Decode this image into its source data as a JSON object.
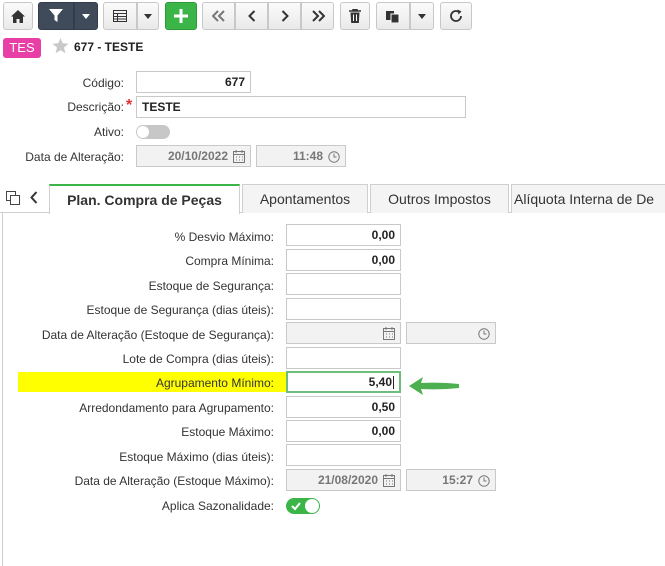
{
  "record": {
    "badge": "TES",
    "title": "677 - TESTE"
  },
  "header_form": {
    "codigo_label": "Código:",
    "codigo_value": "677",
    "descricao_label": "Descrição:",
    "descricao_required": "*",
    "descricao_value": "TESTE",
    "ativo_label": "Ativo:",
    "ativo_on": false,
    "data_alteracao_label": "Data de Alteração:",
    "data_alteracao_date": "20/10/2022",
    "data_alteracao_time": "11:48"
  },
  "tabs": [
    {
      "label": "Plan. Compra de Peças",
      "active": true
    },
    {
      "label": "Apontamentos",
      "active": false
    },
    {
      "label": "Outros Impostos",
      "active": false
    },
    {
      "label": "Alíquota Interna de De",
      "active": false
    }
  ],
  "fields": {
    "desvio_maximo": {
      "label": "% Desvio Máximo:",
      "value": "0,00"
    },
    "compra_minima": {
      "label": "Compra Mínima:",
      "value": "0,00"
    },
    "estoque_seguranca": {
      "label": "Estoque de Segurança:",
      "value": ""
    },
    "estoque_seguranca_dias": {
      "label": "Estoque de Segurança (dias úteis):",
      "value": ""
    },
    "data_alteracao_seguranca": {
      "label": "Data de Alteração (Estoque de Segurança):",
      "date": "",
      "time": ""
    },
    "lote_compra": {
      "label": "Lote de Compra (dias úteis):",
      "value": ""
    },
    "agrupamento_minimo": {
      "label": "Agrupamento Mínimo:",
      "value": "5,40"
    },
    "arredondamento": {
      "label": "Arredondamento para Agrupamento:",
      "value": "0,50"
    },
    "estoque_maximo": {
      "label": "Estoque Máximo:",
      "value": "0,00"
    },
    "estoque_maximo_dias": {
      "label": "Estoque Máximo (dias úteis):",
      "value": ""
    },
    "data_alteracao_maximo": {
      "label": "Data de Alteração (Estoque Máximo):",
      "date": "21/08/2020",
      "time": "15:27"
    },
    "aplica_sazonalidade": {
      "label": "Aplica Sazonalidade:",
      "on": true
    }
  },
  "colors": {
    "accent_green": "#3cb548",
    "highlight_yellow": "#ffff00",
    "badge_pink": "#e83fa6",
    "toolbar_dark": "#3f4b5b"
  },
  "icons": [
    "home-icon",
    "filter-icon",
    "caret-down-icon",
    "grid-icon",
    "plus-icon",
    "first-page-icon",
    "prev-icon",
    "next-icon",
    "last-page-icon",
    "trash-icon",
    "copy-icon",
    "refresh-icon",
    "star-icon",
    "calendar-icon",
    "clock-icon",
    "tabs-icon",
    "chevron-left-icon",
    "arrow-left-icon"
  ]
}
